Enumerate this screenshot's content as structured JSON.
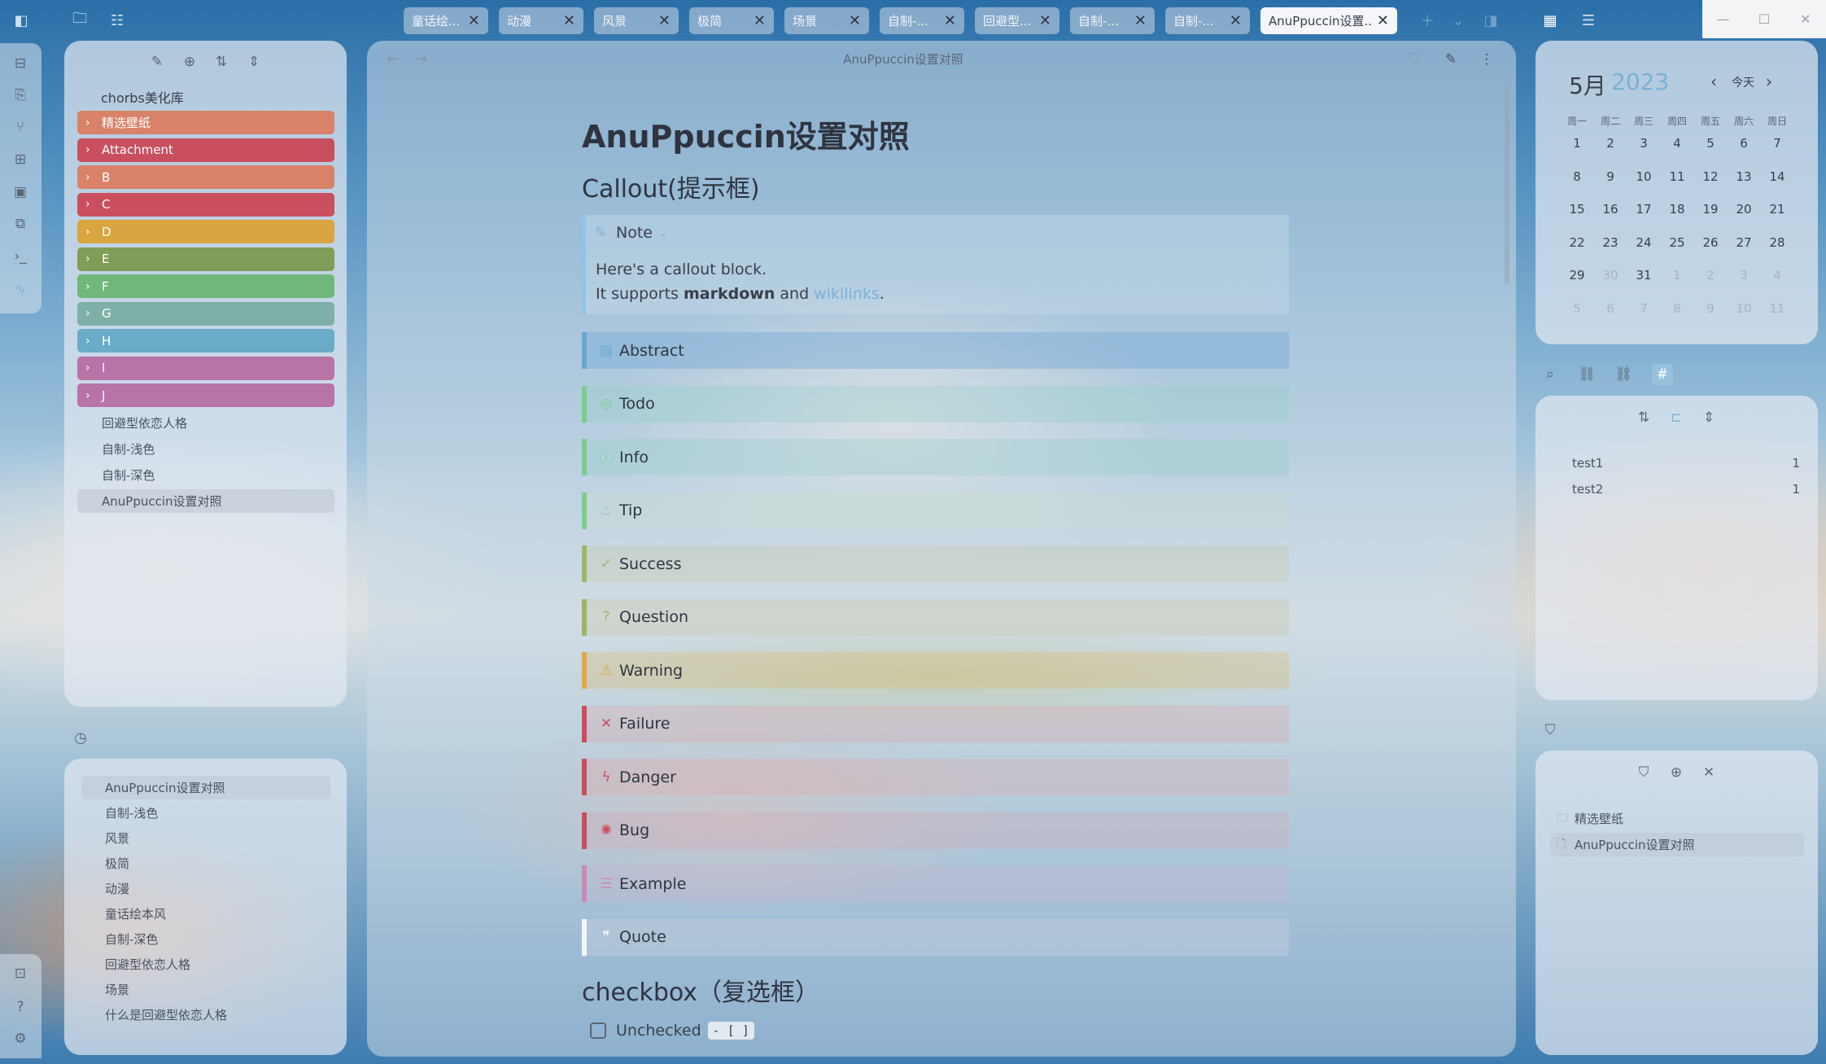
{
  "tabs": [
    {
      "label": "童话绘..."
    },
    {
      "label": "动漫"
    },
    {
      "label": "风景"
    },
    {
      "label": "极简"
    },
    {
      "label": "场景"
    },
    {
      "label": "自制-..."
    },
    {
      "label": "回避型..."
    },
    {
      "label": "自制-..."
    },
    {
      "label": "自制-..."
    },
    {
      "label": "AnuPpuccin设置..."
    }
  ],
  "window_controls": {
    "minimize": "—",
    "maximize": "☐",
    "close": "✕"
  },
  "file_tree": {
    "vault_name": "chorbs美化库",
    "folders": [
      {
        "label": "精选壁纸",
        "color": "#d8826a"
      },
      {
        "label": "Attachment",
        "color": "#c94f5e"
      },
      {
        "label": "B",
        "color": "#d8826a"
      },
      {
        "label": "C",
        "color": "#c94f5e"
      },
      {
        "label": "D",
        "color": "#d9a540"
      },
      {
        "label": "E",
        "color": "#7f9e57"
      },
      {
        "label": "F",
        "color": "#6fb87a"
      },
      {
        "label": "G",
        "color": "#7eb0a7"
      },
      {
        "label": "H",
        "color": "#6aacc7"
      },
      {
        "label": "I",
        "color": "#b873a7"
      },
      {
        "label": "J",
        "color": "#b873a7"
      }
    ],
    "files": [
      {
        "label": "回避型依恋人格"
      },
      {
        "label": "自制-浅色"
      },
      {
        "label": "自制-深色"
      },
      {
        "label": "AnuPpuccin设置对照"
      }
    ]
  },
  "recent_files": [
    {
      "label": "AnuPpuccin设置对照"
    },
    {
      "label": "自制-浅色"
    },
    {
      "label": "风景"
    },
    {
      "label": "极简"
    },
    {
      "label": "动漫"
    },
    {
      "label": "童话绘本风"
    },
    {
      "label": "自制-深色"
    },
    {
      "label": "回避型依恋人格"
    },
    {
      "label": "场景"
    },
    {
      "label": "什么是回避型依恋人格"
    }
  ],
  "editor": {
    "view_title": "AnuPpuccin设置对照",
    "h1": "AnuPpuccin设置对照",
    "section_callout": "Callout(提示框)",
    "note": {
      "title": "Note",
      "line1": "Here's a callout block.",
      "line2_pre": "It supports ",
      "line2_bold": "markdown",
      "line2_mid": " and ",
      "line2_link": "wikilinks",
      "line2_end": "."
    },
    "callouts": [
      {
        "label": "Abstract",
        "icon": "clipboard-icon",
        "glyph": "▤",
        "color": "#6aa6d0",
        "bg": "rgba(120,170,215,0.45)"
      },
      {
        "label": "Todo",
        "icon": "check-circle-icon",
        "glyph": "◎",
        "color": "#7ecb8c",
        "bg": "rgba(150,205,200,0.35)"
      },
      {
        "label": "Info",
        "icon": "info-icon",
        "glyph": "ⓘ",
        "color": "#7ecb8c",
        "bg": "rgba(150,205,200,0.35)"
      },
      {
        "label": "Tip",
        "icon": "flame-icon",
        "glyph": "♨",
        "color": "#7ecb8c",
        "bg": "rgba(200,220,200,0.35)"
      },
      {
        "label": "Success",
        "icon": "check-icon",
        "glyph": "✓",
        "color": "#9fb56a",
        "bg": "rgba(200,200,170,0.35)"
      },
      {
        "label": "Question",
        "icon": "help-circle-icon",
        "glyph": "?",
        "color": "#9fb56a",
        "bg": "rgba(200,200,170,0.35)"
      },
      {
        "label": "Warning",
        "icon": "alert-triangle-icon",
        "glyph": "⚠",
        "color": "#e0a84a",
        "bg": "rgba(220,190,120,0.35)"
      },
      {
        "label": "Failure",
        "icon": "x-icon",
        "glyph": "✕",
        "color": "#c94f5e",
        "bg": "rgba(220,170,170,0.35)"
      },
      {
        "label": "Danger",
        "icon": "zap-icon",
        "glyph": "ϟ",
        "color": "#c94f5e",
        "bg": "rgba(220,170,170,0.35)"
      },
      {
        "label": "Bug",
        "icon": "bug-icon",
        "glyph": "✺",
        "color": "#c94f5e",
        "bg": "rgba(210,170,180,0.35)"
      },
      {
        "label": "Example",
        "icon": "list-icon",
        "glyph": "☰",
        "color": "#c98ab5",
        "bg": "rgba(200,180,205,0.35)"
      },
      {
        "label": "Quote",
        "icon": "quote-icon",
        "glyph": "❞",
        "color": "#f4f6f9",
        "bg": "rgba(200,210,222,0.35)"
      }
    ],
    "section_checkbox": "checkbox（复选框）",
    "checkbox_unchecked": {
      "label": "Unchecked",
      "code": "- [ ]"
    }
  },
  "calendar": {
    "month": "5月",
    "year": "2023",
    "today": "今天",
    "weekdays": [
      "周一",
      "周二",
      "周三",
      "周四",
      "周五",
      "周六",
      "周日"
    ],
    "weeks": [
      [
        {
          "d": "1"
        },
        {
          "d": "2"
        },
        {
          "d": "3"
        },
        {
          "d": "4"
        },
        {
          "d": "5"
        },
        {
          "d": "6"
        },
        {
          "d": "7"
        }
      ],
      [
        {
          "d": "8"
        },
        {
          "d": "9"
        },
        {
          "d": "10"
        },
        {
          "d": "11"
        },
        {
          "d": "12"
        },
        {
          "d": "13"
        },
        {
          "d": "14"
        }
      ],
      [
        {
          "d": "15"
        },
        {
          "d": "16"
        },
        {
          "d": "17"
        },
        {
          "d": "18"
        },
        {
          "d": "19"
        },
        {
          "d": "20"
        },
        {
          "d": "21"
        }
      ],
      [
        {
          "d": "22"
        },
        {
          "d": "23"
        },
        {
          "d": "24"
        },
        {
          "d": "25"
        },
        {
          "d": "26"
        },
        {
          "d": "27"
        },
        {
          "d": "28"
        }
      ],
      [
        {
          "d": "29"
        },
        {
          "d": "30",
          "dim": true
        },
        {
          "d": "31"
        },
        {
          "d": "1",
          "dim": true
        },
        {
          "d": "2",
          "dim": true
        },
        {
          "d": "3",
          "dim": true
        },
        {
          "d": "4",
          "dim": true
        }
      ],
      [
        {
          "d": "5",
          "dim": true
        },
        {
          "d": "6",
          "dim": true
        },
        {
          "d": "7",
          "dim": true
        },
        {
          "d": "8",
          "dim": true
        },
        {
          "d": "9",
          "dim": true
        },
        {
          "d": "10",
          "dim": true
        },
        {
          "d": "11",
          "dim": true
        }
      ]
    ]
  },
  "tags": [
    {
      "name": "test1",
      "count": "1"
    },
    {
      "name": "test2",
      "count": "1"
    }
  ],
  "bookmarks": [
    {
      "label": "精选壁纸",
      "icon": "folder-icon"
    },
    {
      "label": "AnuPpuccin设置对照",
      "icon": "file-icon"
    }
  ]
}
